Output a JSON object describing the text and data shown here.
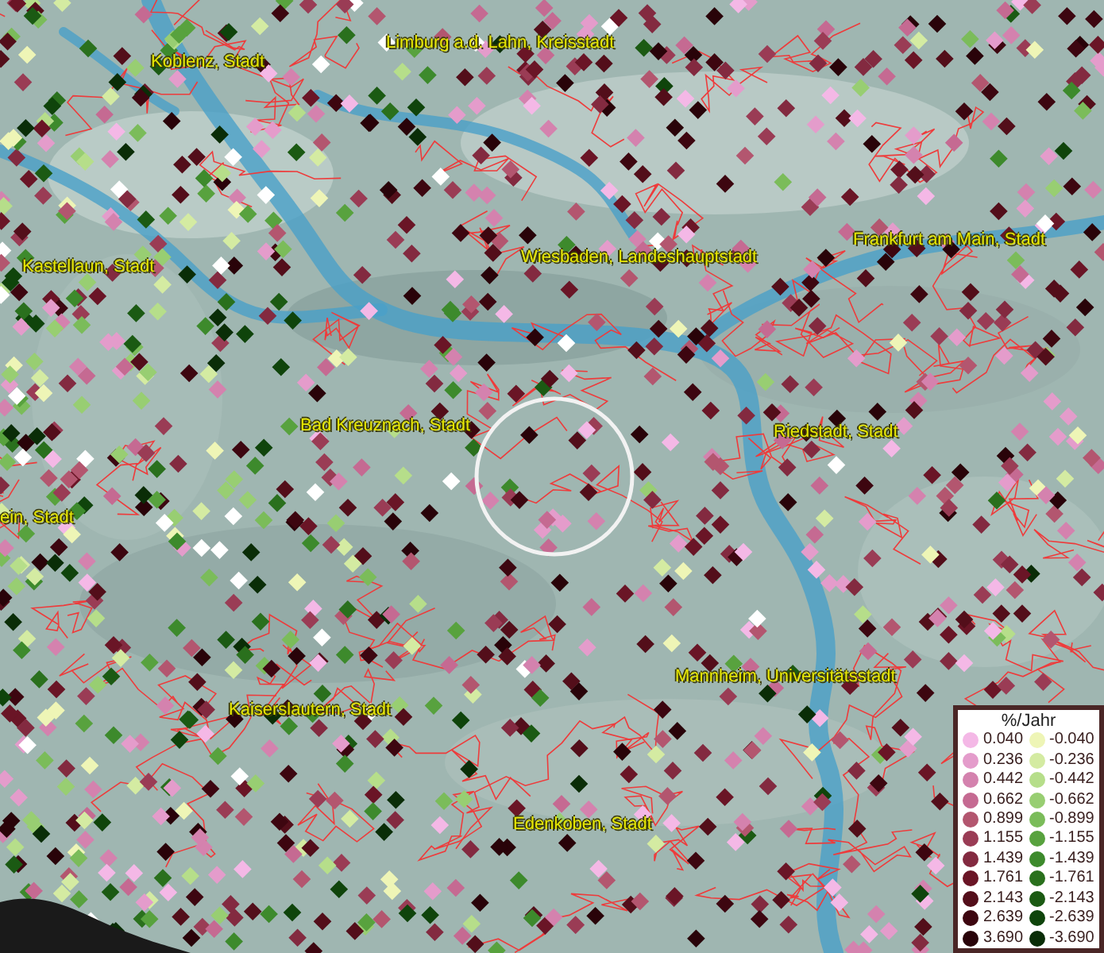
{
  "map": {
    "place_labels": [
      {
        "text": "Koblenz, Stadt"
      },
      {
        "text": "Limburg a.d. Lahn, Kreisstadt"
      },
      {
        "text": "Kastellaun, Stadt"
      },
      {
        "text": "Wiesbaden, Landeshauptstadt"
      },
      {
        "text": "Frankfurt am Main, Stadt"
      },
      {
        "text": "Bad Kreuznach, Stadt"
      },
      {
        "text": "Riedstadt, Stadt"
      },
      {
        "text": "ein, Stadt"
      },
      {
        "text": "Kaiserslautern, Stadt"
      },
      {
        "text": "Mannheim, Universitätsstadt"
      },
      {
        "text": "Edenkoben, Stadt"
      }
    ]
  },
  "legend": {
    "title": "%/Jahr",
    "rows": [
      {
        "positive": {
          "label": "0.040",
          "color": "#f4b8e6"
        },
        "negative": {
          "label": "-0.040",
          "color": "#eef5b6"
        }
      },
      {
        "positive": {
          "label": "0.236",
          "color": "#e49ccb"
        },
        "negative": {
          "label": "-0.236",
          "color": "#d4eba2"
        }
      },
      {
        "positive": {
          "label": "0.442",
          "color": "#d482ae"
        },
        "negative": {
          "label": "-0.442",
          "color": "#b6de8a"
        }
      },
      {
        "positive": {
          "label": "0.662",
          "color": "#c56a92"
        },
        "negative": {
          "label": "-0.662",
          "color": "#98ce72"
        }
      },
      {
        "positive": {
          "label": "0.899",
          "color": "#b3566f"
        },
        "negative": {
          "label": "-0.899",
          "color": "#7bbc5a"
        }
      },
      {
        "positive": {
          "label": "1.155",
          "color": "#9a3c55"
        },
        "negative": {
          "label": "-1.155",
          "color": "#58a23e"
        }
      },
      {
        "positive": {
          "label": "1.439",
          "color": "#832a40"
        },
        "negative": {
          "label": "-1.439",
          "color": "#3d8a2c"
        }
      },
      {
        "positive": {
          "label": "1.761",
          "color": "#6a1526"
        },
        "negative": {
          "label": "-1.761",
          "color": "#2a701d"
        }
      },
      {
        "positive": {
          "label": "2.143",
          "color": "#530e1a"
        },
        "negative": {
          "label": "-2.143",
          "color": "#1b5a13"
        }
      },
      {
        "positive": {
          "label": "2.639",
          "color": "#3d0610"
        },
        "negative": {
          "label": "-2.639",
          "color": "#0f440b"
        }
      },
      {
        "positive": {
          "label": "3.690",
          "color": "#290309"
        },
        "negative": {
          "label": "-3.690",
          "color": "#0a2d07"
        }
      }
    ]
  }
}
